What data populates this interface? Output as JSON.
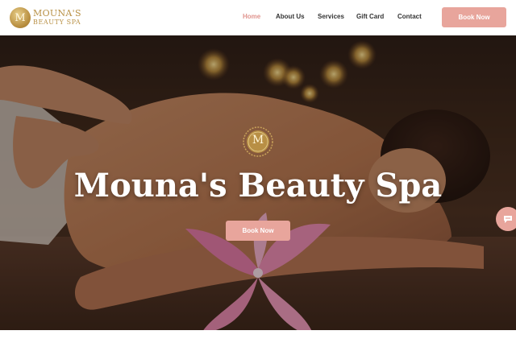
{
  "logo": {
    "initial": "M",
    "line1": "MOUNA'S",
    "line2": "BEAUTY SPA"
  },
  "nav": {
    "items": [
      {
        "label": "Home",
        "active": true
      },
      {
        "label": "About Us",
        "active": false
      },
      {
        "label": "Services",
        "active": false
      },
      {
        "label": "Gift Card",
        "active": false
      },
      {
        "label": "Contact",
        "active": false
      }
    ],
    "cta_label": "Book Now"
  },
  "hero": {
    "emblem_initial": "M",
    "title": "Mouna's Beauty Spa",
    "cta_label": "Book Now"
  },
  "colors": {
    "accent": "#e8a59c",
    "active_link": "#e0948e",
    "gold": "#b89045"
  },
  "icons": {
    "chat": "chat-icon",
    "emblem": "monogram-emblem-icon"
  }
}
